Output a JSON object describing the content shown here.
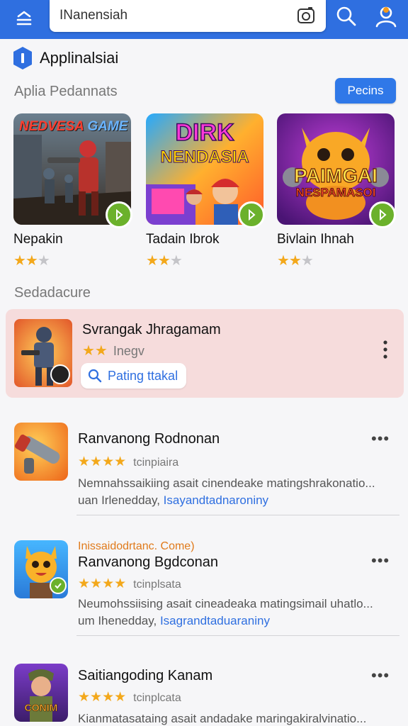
{
  "search": {
    "value": "INanensiah"
  },
  "app": {
    "title": "Applinalsiai"
  },
  "featured": {
    "section_label": "Aplia Pedannats",
    "action_label": "Pecins",
    "items": [
      {
        "name": "Nepakin",
        "art_text": [
          "NEDVESA",
          "GAME"
        ],
        "rating": 2
      },
      {
        "name": "Tadain Ibrok",
        "art_text": [
          "DIRK",
          "NENDASIA"
        ],
        "rating": 2
      },
      {
        "name": "Bivlain Ihnah",
        "art_text": [
          "PAIMGAI",
          "NESPAMASOI"
        ],
        "rating": 2
      }
    ]
  },
  "secondary_label": "Sedadacure",
  "promo": {
    "name": "Svrangak Jhragamam",
    "rating_text": "Inegv",
    "rating": 2,
    "chip_label": "Pating ttakal"
  },
  "list": [
    {
      "tag": "",
      "name": "Ranvanong Rodnonan",
      "rating": 4,
      "rating_text": "tcinpiaira",
      "desc": "Nemnahssaikiing asait cinendeake matingshrakonatio...",
      "desc2_prefix": "uan Irlenedday, ",
      "desc2_link": "Isayandtadnaroniny"
    },
    {
      "tag": "Inissaidodrtanc. Come)",
      "name": "Ranvanong Bgdconan",
      "rating": 4,
      "rating_text": "tcinplsata",
      "desc": "Neumohssiising asait cineadeaka matingsimail uhatlo...",
      "desc2_prefix": "um Ihenedday, ",
      "desc2_link": "Isagrandtaduaraniny"
    },
    {
      "tag": "",
      "name": "Saitiangoding Kanam",
      "rating": 4,
      "rating_text": "tcinplcata",
      "desc": "Kianmatasataing asait andadake maringakiralvinatio...",
      "desc2_prefix": "",
      "desc2_link": ""
    }
  ],
  "icon_art_text": "CONIM",
  "colors": {
    "header": "#2f6fe0",
    "accent": "#2f78e8",
    "star": "#f3a81b",
    "badge": "#6bb12b",
    "promo_bg": "#f6dcdc",
    "tag": "#e07a1b"
  }
}
